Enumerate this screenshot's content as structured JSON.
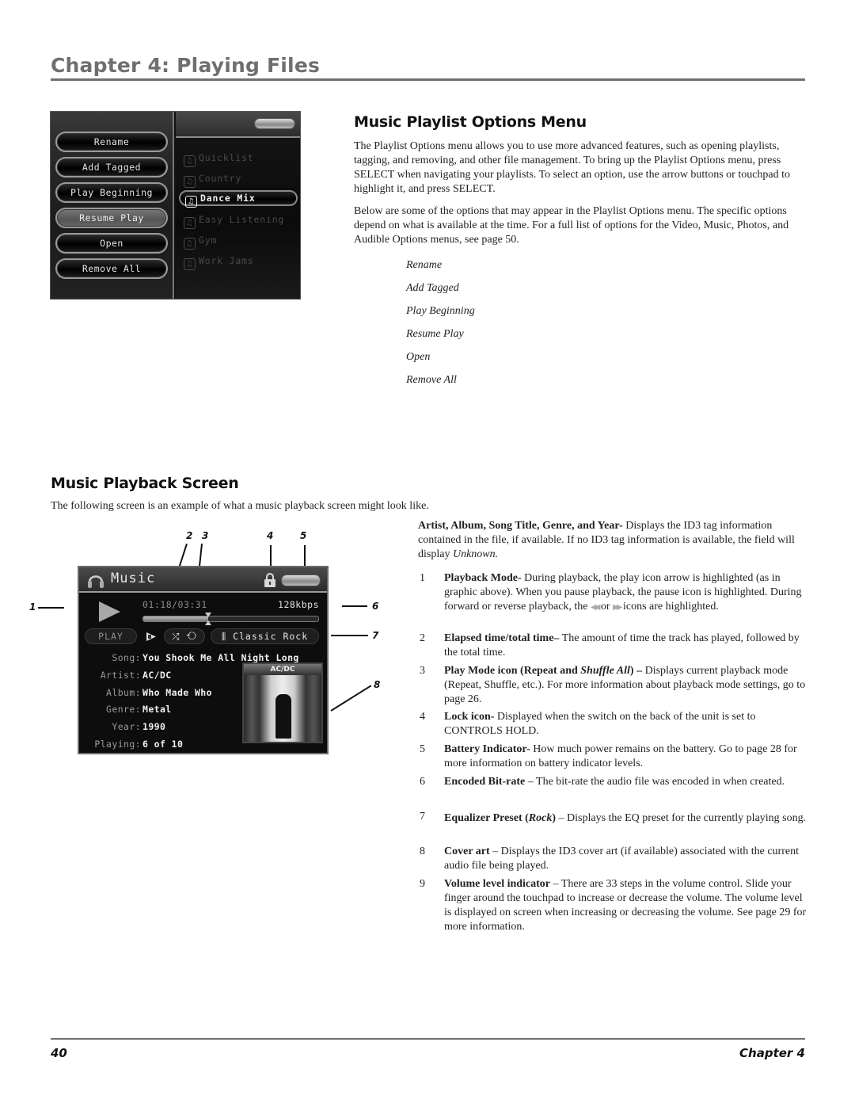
{
  "header": {
    "chapter_title": "Chapter 4: Playing Files"
  },
  "playlist_section": {
    "heading": "Music Playlist Options Menu",
    "paragraphs": [
      "The Playlist Options menu allows you to use more advanced features, such as opening playlists, tagging, and removing, and other file management. To bring up the Playlist Options menu, press SELECT when navigating your playlists. To select an option, use the arrow buttons or touchpad to highlight it, and press SELECT.",
      "Below are some of the options that may appear in the Playlist Options menu.  The specific options depend on what is available at the time. For a full list of options for the Video, Music, Photos, and Audible Options menus, see page 50."
    ],
    "options": [
      "Rename",
      "Add Tagged",
      "Play Beginning",
      "Resume Play",
      "Open",
      "Remove All"
    ]
  },
  "playlist_screen": {
    "menu_buttons": [
      {
        "label": "Rename",
        "selected": false
      },
      {
        "label": "Add Tagged",
        "selected": false
      },
      {
        "label": "Play Beginning",
        "selected": false
      },
      {
        "label": "Resume Play",
        "selected": true
      },
      {
        "label": "Open",
        "selected": false
      },
      {
        "label": "Remove All",
        "selected": false
      }
    ],
    "playlists": [
      {
        "label": "Quicklist",
        "selected": false
      },
      {
        "label": "Country",
        "selected": false
      },
      {
        "label": "Dance Mix",
        "selected": true
      },
      {
        "label": "Easy Listening",
        "selected": false
      },
      {
        "label": "Gym",
        "selected": false
      },
      {
        "label": "Work Jams",
        "selected": false
      }
    ],
    "music_icon_glyph": "♫"
  },
  "playback_section": {
    "heading": "Music Playback Screen",
    "intro": "The following screen is an example of what a music playback screen might look like."
  },
  "playback_screen": {
    "title": "Music",
    "time": "01:18/03:31",
    "bitrate": "128kbps",
    "progress_fraction": 0.37,
    "play_label": "PLAY",
    "mode_icons": "⤮ ⟲",
    "eq_preset": "Classic Rock",
    "eq_icon_glyph": "⫼",
    "info": [
      {
        "label": "Song:",
        "value": "You Shook Me All Night Long"
      },
      {
        "label": "Artist:",
        "value": "AC/DC"
      },
      {
        "label": "Album:",
        "value": "Who Made Who"
      },
      {
        "label": "Genre:",
        "value": "Metal"
      },
      {
        "label": "Year:",
        "value": "1990"
      },
      {
        "label": "Playing:",
        "value": "6 of 10"
      }
    ],
    "cover_band": "AC/DC"
  },
  "callouts": [
    "1",
    "2",
    "3",
    "4",
    "5",
    "6",
    "7",
    "8"
  ],
  "descriptions": {
    "intro_bold": "Artist, Album, Song Title, Genre, and Year-",
    "intro_text": " Displays the ID3 tag information contained in the file, if available. If no ID3 tag information is available, the field will display ",
    "intro_italic": "Unknown.",
    "items": [
      {
        "num": "1",
        "bold": "Playback Mode-",
        "text": "  During playback, the play icon arrow is highlighted (as in graphic above). When you pause playback, the pause icon is highlighted. During forward or reverse playback, the ",
        "rew": "◀◀",
        "or": " or ",
        "ff": "▶▶",
        "text2": " icons are highlighted."
      },
      {
        "num": "2",
        "bold": "Elapsed time/total time–",
        "text": " The amount of time the track has played, followed by the total time."
      },
      {
        "num": "3",
        "bold": "Play Mode icon (Repeat and ",
        "bold_italic": "Shuffle All",
        "bold2": ") –",
        "text": " Displays current playback mode (Repeat, Shuffle, etc.). For more information about playback mode settings, go to page 26."
      },
      {
        "num": "4",
        "bold": "Lock icon-",
        "text": " Displayed when the switch on the back of the unit is set to CONTROLS HOLD."
      },
      {
        "num": "5",
        "bold": "Battery Indicator-",
        "text": " How much power remains on the battery. Go to page 28 for more information on battery indicator levels."
      },
      {
        "num": "6",
        "bold": "Encoded Bit-rate",
        "text": " –  The bit-rate the audio file was encoded in when created."
      },
      {
        "num": "7",
        "bold": "Equalizer Preset (",
        "bold_italic": "Rock",
        "bold2": ")",
        "text": " –  Displays the EQ preset for the currently playing song."
      },
      {
        "num": "8",
        "bold": "Cover art",
        "text": " – Displays the ID3 cover art (if available) associated with the current audio file being played."
      },
      {
        "num": "9",
        "bold": "Volume level indicator",
        "text": "  –  There are 33 steps in the volume control. Slide your finger around the touchpad to increase or decrease the volume. The volume level is displayed on screen when increasing or decreasing the volume. See page 29 for more information."
      }
    ]
  },
  "footer": {
    "page_number": "40",
    "chapter_label": "Chapter  4"
  }
}
